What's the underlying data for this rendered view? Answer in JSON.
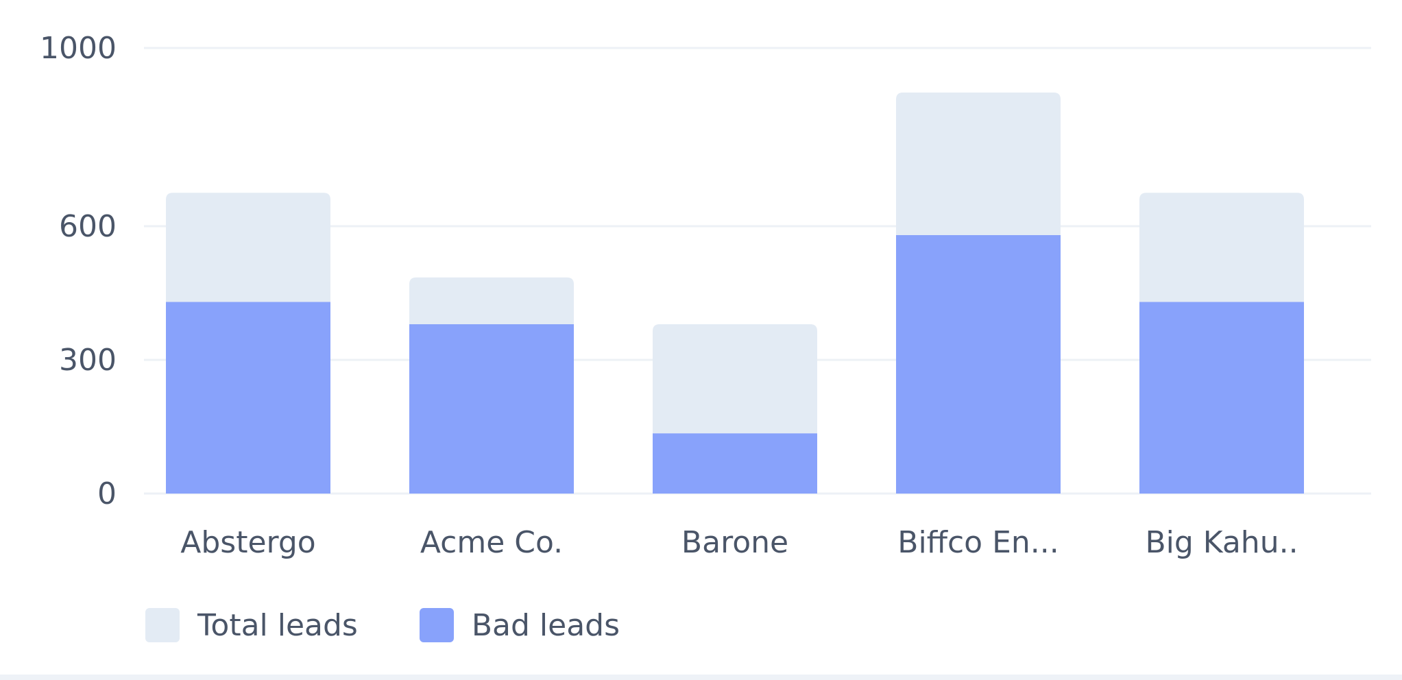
{
  "chart_data": {
    "type": "bar",
    "stacking": "overlay",
    "categories": [
      "Abstergo",
      "Acme Co.",
      "Barone",
      "Biffco En...",
      "Big Kahu.."
    ],
    "series": [
      {
        "name": "Total leads",
        "values": [
          675,
          485,
          380,
          900,
          675
        ],
        "color": "#e3ebf4"
      },
      {
        "name": "Bad leads",
        "values": [
          430,
          380,
          135,
          580,
          430
        ],
        "color": "#88a2fb"
      }
    ],
    "y_ticks": [
      0,
      300,
      600,
      1000
    ],
    "ylim": [
      0,
      1000
    ],
    "grid": true,
    "legend_position": "bottom-left"
  }
}
